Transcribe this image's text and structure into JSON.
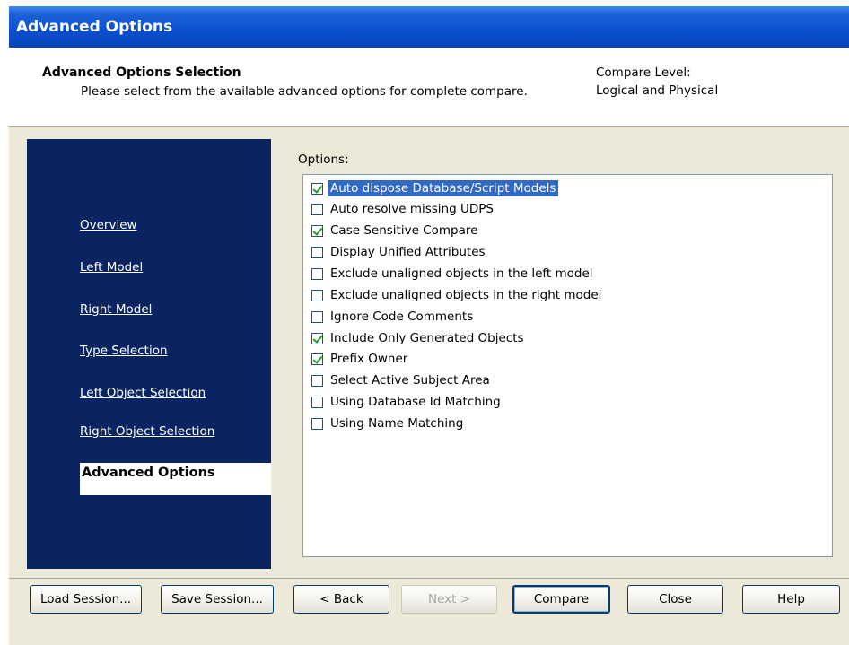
{
  "window": {
    "title": "Advanced Options"
  },
  "header": {
    "title": "Advanced Options Selection",
    "subtitle": "Please select from the available advanced options for complete compare.",
    "compare_level_label": "Compare Level:",
    "compare_level_value": "Logical and Physical"
  },
  "nav": {
    "items": [
      {
        "label": "Overview"
      },
      {
        "label": "Left Model"
      },
      {
        "label": "Right Model"
      },
      {
        "label": "Type Selection"
      },
      {
        "label": "Left Object Selection"
      },
      {
        "label": "Right Object Selection"
      }
    ],
    "active": "Advanced Options"
  },
  "options": {
    "label": "Options:",
    "items": [
      {
        "label": "Auto dispose Database/Script Models",
        "checked": true,
        "selected": true
      },
      {
        "label": "Auto resolve missing UDPS",
        "checked": false
      },
      {
        "label": "Case Sensitive Compare",
        "checked": true
      },
      {
        "label": "Display Unified Attributes",
        "checked": false
      },
      {
        "label": "Exclude unaligned objects in the left model",
        "checked": false
      },
      {
        "label": "Exclude unaligned objects in the right model",
        "checked": false
      },
      {
        "label": "Ignore Code Comments",
        "checked": false
      },
      {
        "label": "Include Only Generated Objects",
        "checked": true
      },
      {
        "label": "Prefix Owner",
        "checked": true
      },
      {
        "label": "Select Active Subject Area",
        "checked": false
      },
      {
        "label": "Using Database Id Matching",
        "checked": false
      },
      {
        "label": "Using Name Matching",
        "checked": false
      }
    ]
  },
  "buttons": {
    "load": "Load Session...",
    "save": "Save Session...",
    "back": "< Back",
    "next": "Next >",
    "compare": "Compare",
    "close": "Close",
    "help": "Help"
  },
  "colors": {
    "titlebar": "#0a4fd0",
    "nav_background": "#0a2461",
    "dialog_background": "#ece9d8",
    "selection": "#316ac5"
  }
}
